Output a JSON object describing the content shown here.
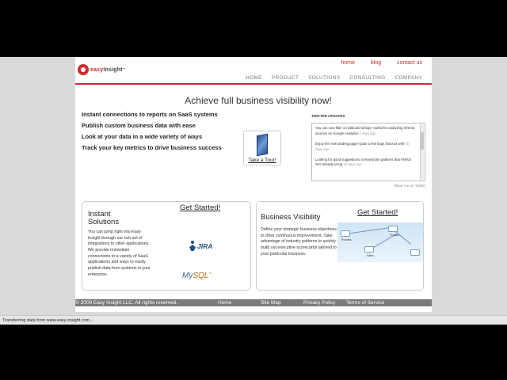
{
  "logo": {
    "text_a": "easy",
    "text_b": "Insight",
    "tm": "™"
  },
  "toplinks": [
    "home",
    "blog",
    "contact us"
  ],
  "nav": [
    "HOME",
    "PRODUCT",
    "SOLUTIONS",
    "CONSULTING",
    "COMPANY"
  ],
  "headline": "Achieve full business visibility now!",
  "features": [
    "Instant connections to reports on SaaS systems",
    "Publish custom business data with ease",
    "Look at your data in a wide variety of ways",
    "Track your key metrics to drive business success"
  ],
  "tour": {
    "label": "Take a Tour!"
  },
  "twitter": {
    "title": "TWITTER UPDATES",
    "items": [
      {
        "text": "You can now filter on wildcard strings--useful for analyzing referral sources on Google Analytics",
        "time": "4 days ago"
      },
      {
        "text": "Enjoy the new landing page! Quite a few bugs fixed as well",
        "time": "15 days ago"
      },
      {
        "text": "Looking for good suggestions on keystroke patterns that Firefox isn't already using",
        "time": "18 days ago"
      }
    ],
    "follow": "follow me on Twitter"
  },
  "card1": {
    "heading": "Instant Solutions",
    "get_started": "Get Started!",
    "body": "You can jump right into Easy Insight through our rich set of integrations to other applications. We provide immediate connections to a variety of SaaS applications and ways to easily publish data from systems in your enterprise.",
    "jira": "JIRA",
    "mysql_a": "My",
    "mysql_b": "SQL",
    "mysql_tm": "™"
  },
  "card2": {
    "heading": "Business Visibility",
    "get_started": "Get Started!",
    "body": "Define your strategic business objectives to drive continuous improvement. Take advantage of industry patterns to quickly build out executive scorecards tailored to your particular business.",
    "diagram_labels": [
      "Product",
      "Process",
      "Sales"
    ]
  },
  "footer": {
    "copyright": "© 2009 Easy Insight LLC. All rights reserved.",
    "links": [
      "Home",
      "Site Map",
      "Privacy Policy",
      "Terms of Service"
    ]
  },
  "status": "Transferring data from www.easy-insight.com..."
}
